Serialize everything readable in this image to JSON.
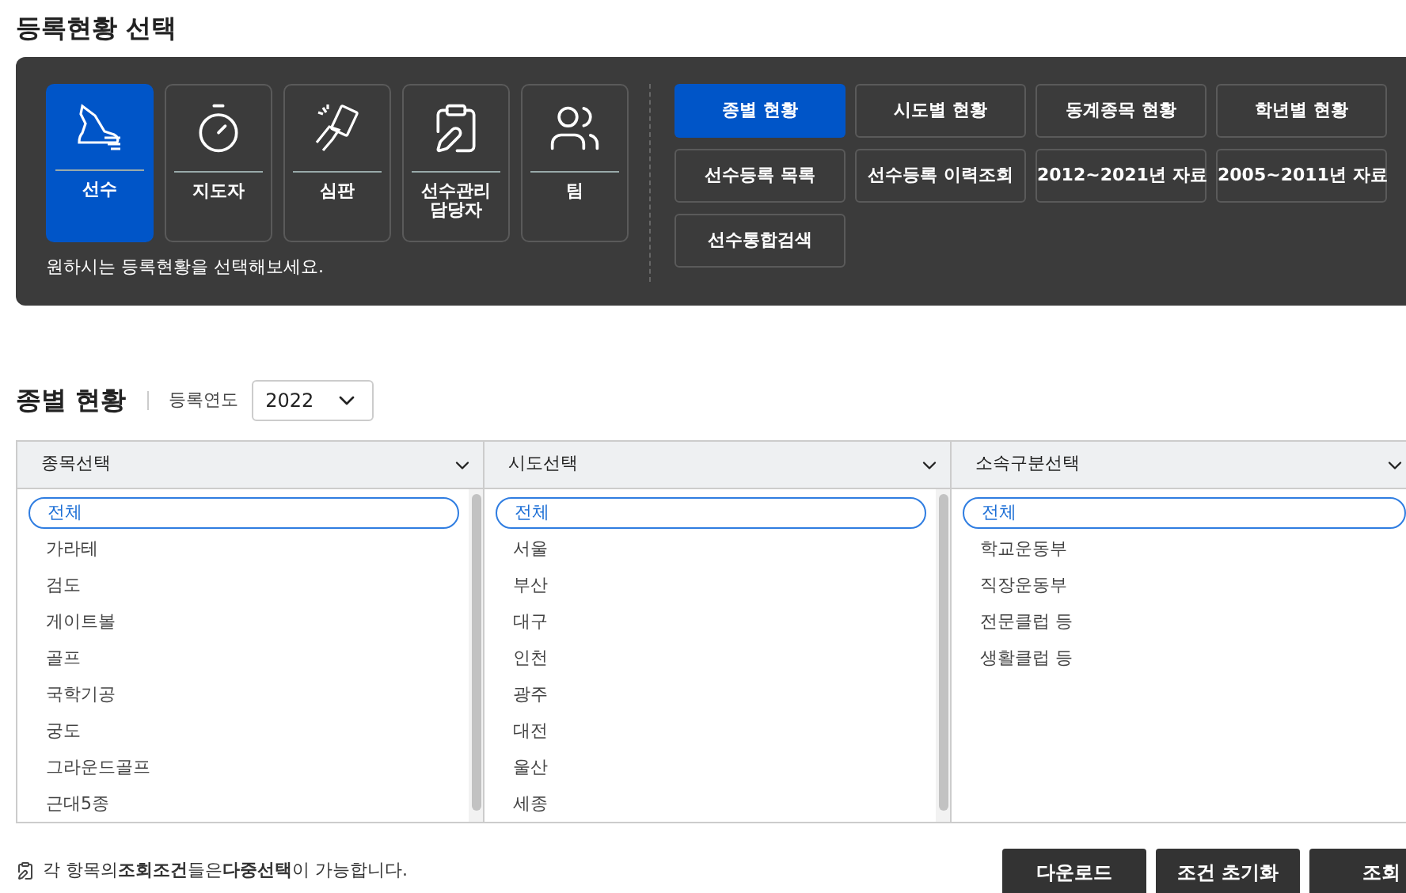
{
  "page_title": "등록현황 선택",
  "categories": [
    {
      "label": "선수",
      "kind": "shoe",
      "selected": true
    },
    {
      "label": "지도자",
      "kind": "stopwatch",
      "selected": false
    },
    {
      "label": "심판",
      "kind": "card",
      "selected": false
    },
    {
      "label": "선수관리 담당자",
      "kind": "desk",
      "selected": false
    },
    {
      "label": "팀",
      "kind": "group",
      "selected": false
    }
  ],
  "hint": "원하시는 등록현황을 선택해보세요.",
  "reports": [
    {
      "label": "종별 현황",
      "selected": true
    },
    {
      "label": "시도별 현황",
      "selected": false
    },
    {
      "label": "동계종목 현황",
      "selected": false
    },
    {
      "label": "학년별 현황",
      "selected": false
    },
    {
      "label": "선수등록 목록",
      "selected": false
    },
    {
      "label": "선수등록 이력조회",
      "selected": false
    },
    {
      "label": "2012~2021년 자료",
      "selected": false
    },
    {
      "label": "2005~2011년 자료",
      "selected": false
    },
    {
      "label": "선수통합검색",
      "selected": false
    }
  ],
  "section_title": "종별 현황",
  "year_label": "등록연도",
  "year_value": "2022",
  "filters": [
    {
      "header": "종목선택",
      "items": [
        {
          "label": "전체",
          "selected": true
        },
        {
          "label": "가라테",
          "selected": false
        },
        {
          "label": "검도",
          "selected": false
        },
        {
          "label": "게이트볼",
          "selected": false
        },
        {
          "label": "골프",
          "selected": false
        },
        {
          "label": "국학기공",
          "selected": false
        },
        {
          "label": "궁도",
          "selected": false
        },
        {
          "label": "그라운드골프",
          "selected": false
        },
        {
          "label": "근대5종",
          "selected": false
        }
      ]
    },
    {
      "header": "시도선택",
      "items": [
        {
          "label": "전체",
          "selected": true
        },
        {
          "label": "서울",
          "selected": false
        },
        {
          "label": "부산",
          "selected": false
        },
        {
          "label": "대구",
          "selected": false
        },
        {
          "label": "인천",
          "selected": false
        },
        {
          "label": "광주",
          "selected": false
        },
        {
          "label": "대전",
          "selected": false
        },
        {
          "label": "울산",
          "selected": false
        },
        {
          "label": "세종",
          "selected": false
        }
      ]
    },
    {
      "header": "소속구분선택",
      "items": [
        {
          "label": "전체",
          "selected": true
        },
        {
          "label": "학교운동부",
          "selected": false
        },
        {
          "label": "직장운동부",
          "selected": false
        },
        {
          "label": "전문클럽 등",
          "selected": false
        },
        {
          "label": "생활클럽 등",
          "selected": false
        }
      ]
    }
  ],
  "note": "각 항목의**조회조건**들은**다중선택**이 가능합니다.",
  "buttons": [
    "다운로드",
    "조건 초기화",
    "조회"
  ]
}
